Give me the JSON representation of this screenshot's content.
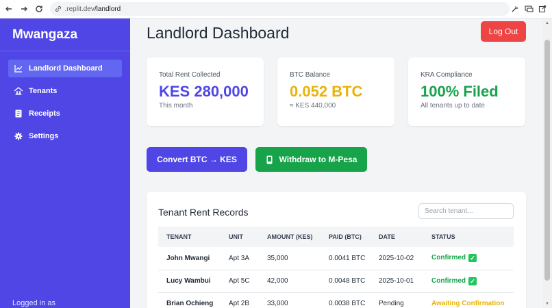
{
  "browser": {
    "url_host": ".replit.dev",
    "url_path": "/landlord"
  },
  "sidebar": {
    "brand": "Mwangaza",
    "items": [
      {
        "label": "Landlord Dashboard",
        "icon": "chart-icon"
      },
      {
        "label": "Tenants",
        "icon": "tenants-icon"
      },
      {
        "label": "Receipts",
        "icon": "receipt-icon"
      },
      {
        "label": "Settings",
        "icon": "gear-icon"
      }
    ],
    "footer": "Logged in as"
  },
  "header": {
    "title": "Landlord Dashboard",
    "logout_label": "Log Out"
  },
  "cards": [
    {
      "label": "Total Rent Collected",
      "value": "KES 280,000",
      "sub": "This month",
      "color": "#4f46e5"
    },
    {
      "label": "BTC Balance",
      "value": "0.052 BTC",
      "sub": "≈ KES 440,000",
      "color": "#eab308"
    },
    {
      "label": "KRA Compliance",
      "value": "100% Filed",
      "sub": "All tenants up to date",
      "color": "#16a34a"
    }
  ],
  "actions": {
    "convert_label": "Convert BTC → KES",
    "withdraw_label": "Withdraw to M-Pesa"
  },
  "records": {
    "title": "Tenant Rent Records",
    "search_placeholder": "Search tenant...",
    "columns": [
      "TENANT",
      "UNIT",
      "AMOUNT (KES)",
      "PAID (BTC)",
      "DATE",
      "STATUS"
    ],
    "rows": [
      {
        "tenant": "John Mwangi",
        "unit": "Apt 3A",
        "amount": "35,000",
        "btc": "0.0041 BTC",
        "date": "2025-10-02",
        "status": "Confirmed",
        "state": "ok"
      },
      {
        "tenant": "Lucy Wambui",
        "unit": "Apt 5C",
        "amount": "42,000",
        "btc": "0.0048 BTC",
        "date": "2025-10-01",
        "status": "Confirmed",
        "state": "ok"
      },
      {
        "tenant": "Brian Ochieng",
        "unit": "Apt 2B",
        "amount": "33,000",
        "btc": "0.0038 BTC",
        "date": "Pending",
        "status": "Awaiting Confirmation",
        "state": "wait"
      }
    ]
  }
}
